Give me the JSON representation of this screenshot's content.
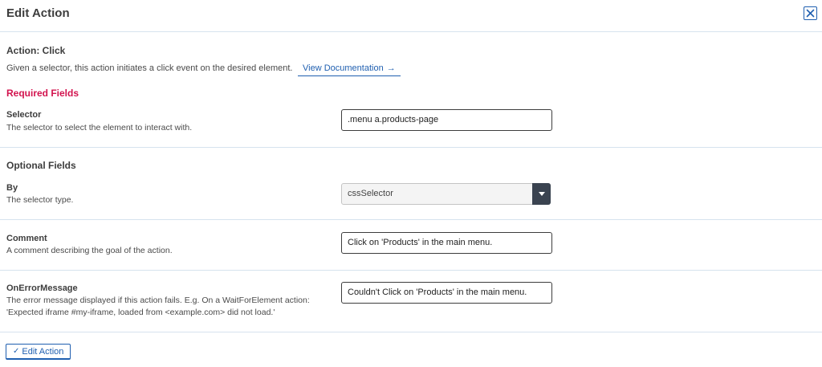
{
  "header": {
    "title": "Edit Action"
  },
  "action": {
    "title": "Action: Click",
    "description": "Given a selector, this action initiates a click event on the desired element.",
    "doc_link_label": "View Documentation",
    "doc_link_arrow": "→"
  },
  "required": {
    "title": "Required Fields",
    "fields": [
      {
        "label": "Selector",
        "description": "The selector to select the element to interact with.",
        "value": ".menu a.products-page"
      }
    ]
  },
  "optional": {
    "title": "Optional Fields",
    "fields": [
      {
        "label": "By",
        "description": "The selector type.",
        "value": "cssSelector"
      },
      {
        "label": "Comment",
        "description": "A comment describing the goal of the action.",
        "value": "Click on 'Products' in the main menu."
      },
      {
        "label": "OnErrorMessage",
        "description_line1": "The error message displayed if this action fails. E.g. On a WaitForElement action:",
        "description_line2": "'Expected iframe #my-iframe, loaded from <example.com> did not load.'",
        "value": "Couldn't Click on 'Products' in the main menu."
      }
    ]
  },
  "submit": {
    "check": "✓",
    "label": "Edit Action"
  },
  "colors": {
    "accent": "#1f5fb0",
    "required": "#d2134e",
    "divider": "#d6e3ee"
  }
}
